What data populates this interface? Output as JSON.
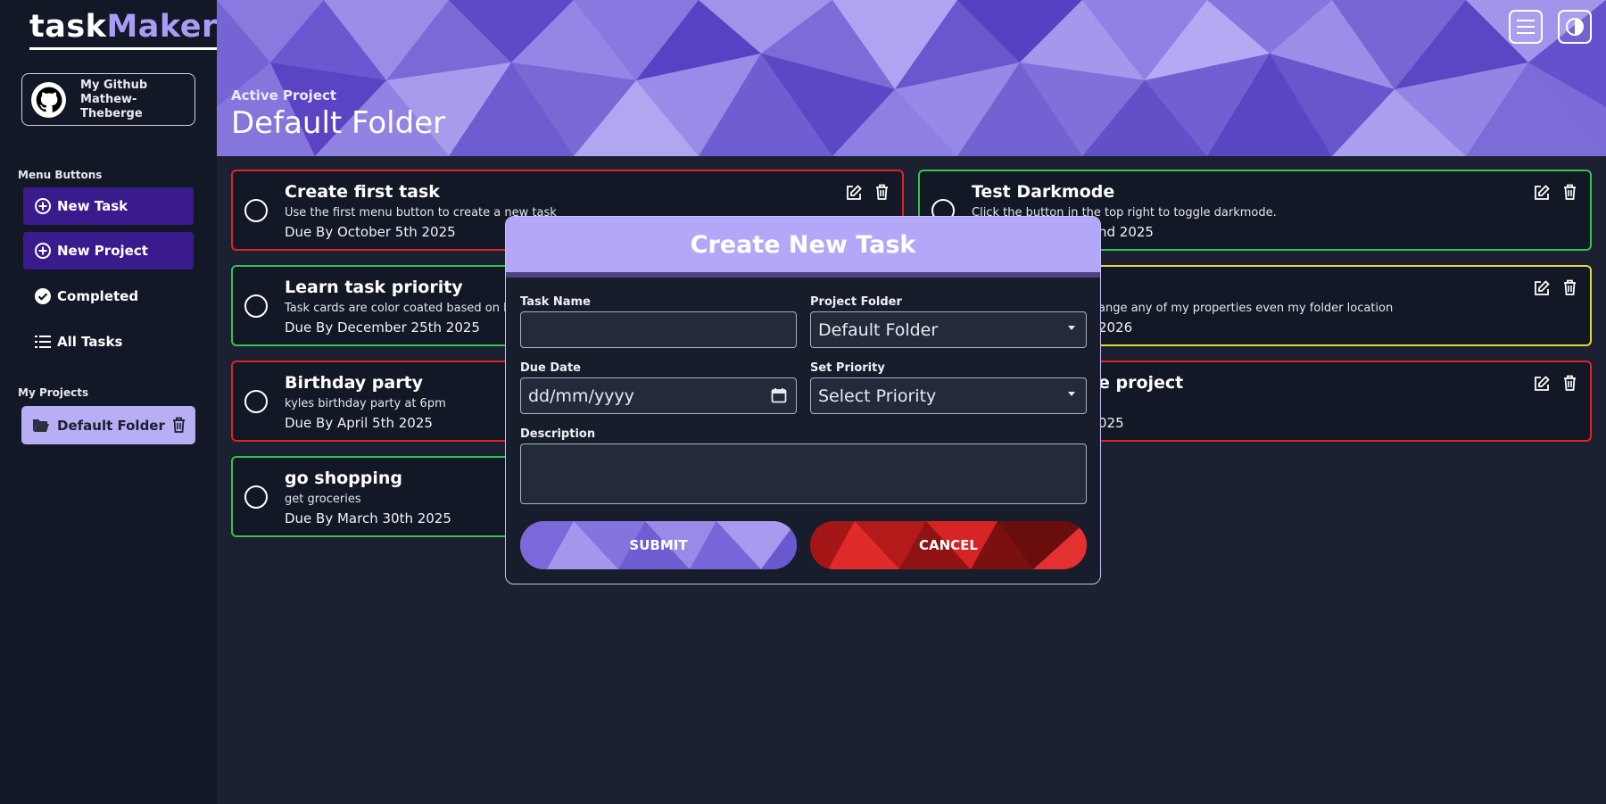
{
  "app": {
    "logo_part1": "task",
    "logo_part2": "Maker",
    "github_line1": "My Github",
    "github_line2": "Mathew-Theberge"
  },
  "sidebar": {
    "menu_label": "Menu Buttons",
    "menu": [
      {
        "label": "New Task",
        "icon": "plus-circle-icon"
      },
      {
        "label": "New Project",
        "icon": "plus-circle-icon"
      },
      {
        "label": "Completed",
        "icon": "check-circle-icon"
      },
      {
        "label": "All Tasks",
        "icon": "list-icon"
      }
    ],
    "projects_label": "My Projects",
    "projects": [
      {
        "label": "Default Folder",
        "icon": "folder-open-icon"
      }
    ]
  },
  "header": {
    "active_label": "Active Project",
    "active_title": "Default Folder",
    "accent": "#7b6ad8"
  },
  "tasks": [
    {
      "title": "Create first task",
      "desc": "Use the first menu button to create a new task",
      "due": "Due By October 5th 2025",
      "priority_color": "#e02424"
    },
    {
      "title": "Learn task priority",
      "desc": "Task cards are color coated based on le",
      "due": "Due By December 25th 2025",
      "priority_color": "#36c24e"
    },
    {
      "title": "Birthday party",
      "desc": "kyles birthday party at 6pm",
      "due": "Due By April 5th 2025",
      "priority_color": "#e02424"
    },
    {
      "title": "go shopping",
      "desc": "get groceries",
      "due": "Due By March 30th 2025",
      "priority_color": "#36c24e"
    },
    {
      "title": "Test Darkmode",
      "desc": "Click the button in the top right to toggle darkmode.",
      "due": "nd 2025",
      "priority_color": "#36c24e"
    },
    {
      "title": "",
      "desc": "ange any of my properties even my folder location",
      "due": "2026",
      "priority_color": "#e3d83a"
    },
    {
      "title": "e project",
      "desc": "",
      "due": "025",
      "priority_color": "#e02424"
    }
  ],
  "modal": {
    "title": "Create New Task",
    "task_name_label": "Task Name",
    "task_name_value": "",
    "project_folder_label": "Project Folder",
    "project_folder_value": "Default Folder",
    "due_date_label": "Due Date",
    "due_date_placeholder": "dd/mm/yyyy",
    "priority_label": "Set Priority",
    "priority_value": "Select Priority",
    "description_label": "Description",
    "submit_label": "SUBMIT",
    "cancel_label": "CANCEL"
  }
}
